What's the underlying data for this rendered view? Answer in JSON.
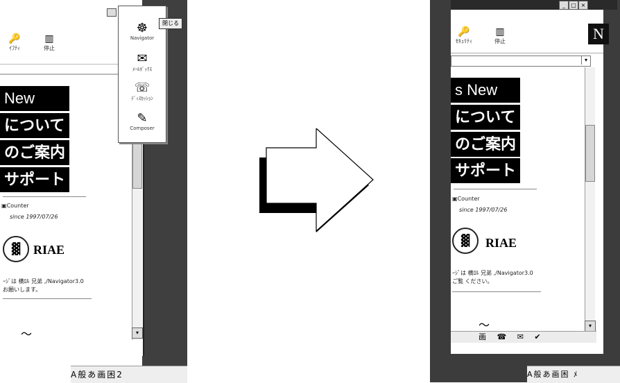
{
  "left": {
    "toolbar": [
      {
        "label": "ｲﾌﾃｨ",
        "icon": "security-icon"
      },
      {
        "label": "停止",
        "icon": "stop-icon"
      }
    ],
    "menu_items": [
      "New",
      "について",
      "のご案内",
      "サポート"
    ],
    "counter_label": "Counter",
    "counter_since": "since 1997/07/26",
    "logo_text": "RIAE",
    "footer_text_1": "ｰｼﾞは 横ﾛﾙ 兄弟 ,/Navigator3.0",
    "footer_text_2": "お願いします。",
    "popup": [
      {
        "label": "Navigator",
        "icon": "navigator-icon"
      },
      {
        "label": "ﾒｰﾙﾎﾞｯｸｽ",
        "icon": "mailbox-icon"
      },
      {
        "label": "ﾃﾞｨｽｶｯｼｮﾝ",
        "icon": "discussion-icon"
      },
      {
        "label": "Composer",
        "icon": "composer-icon"
      }
    ],
    "close_label": "閉じる",
    "taskbar": "A般あ画困2"
  },
  "right": {
    "toolbar": [
      {
        "label": "ｾｷｭﾘﾃｨ",
        "icon": "security-icon"
      },
      {
        "label": "停止",
        "icon": "stop-icon"
      }
    ],
    "netscape_logo": "N",
    "menu_items": [
      "s New",
      "について",
      "のご案内",
      "サポート"
    ],
    "counter_label": "Counter",
    "counter_since": "since 1997/07/26",
    "logo_text": "RIAE",
    "footer_text_1": "ｰｼﾞは 横ﾛﾙ 兄弟 ,/Navigator3.0",
    "footer_text_2": "ご覧 ください。",
    "component_bar": "画 ☎ ✉ ✔",
    "taskbar": "A般あ画困 ﾒ"
  }
}
